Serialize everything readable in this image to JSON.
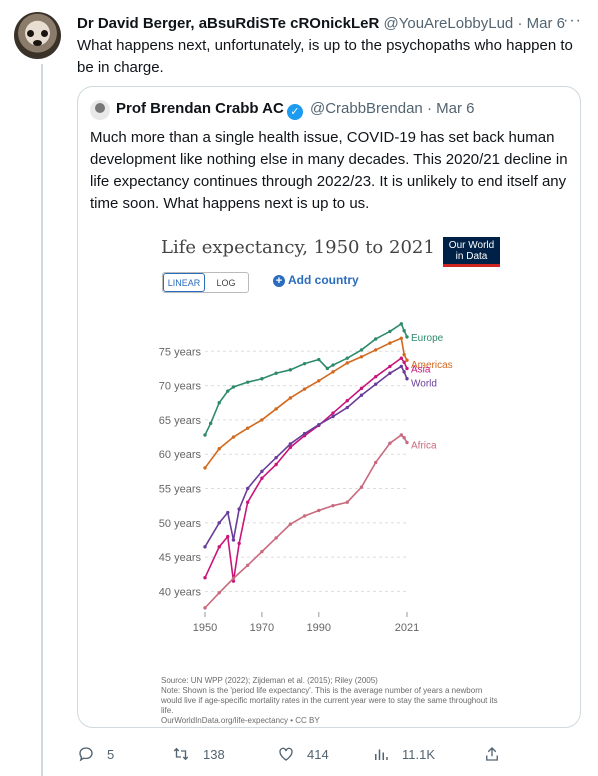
{
  "tweet": {
    "author_name": "Dr David Berger, aBsuRdiSTe cROnickLeR",
    "handle": "@YouAreLobbyLud",
    "separator": "·",
    "date": "Mar 6",
    "more_label": "···",
    "text": "What happens next, unfortunately, is up to the psychopaths who happen to be in charge."
  },
  "quoted": {
    "author_name": "Prof Brendan Crabb AC",
    "verified_mark": "✓",
    "handle": "@CrabbBrendan",
    "separator": "·",
    "date": "Mar 6",
    "text": "Much more than a single health issue, COVID-19 has set back human development like nothing else in many decades. This 2020/21 decline in life expectancy continues through 2022/23. It is unlikely to end itself any time soon. What happens next is up to us."
  },
  "chart_ui": {
    "logo_line1": "Our World",
    "logo_line2": "in Data",
    "linear_label": "LINEAR",
    "log_label": "LOG",
    "add_plus": "+",
    "add_country_label": "Add country",
    "source_line": "Source: UN WPP (2022); Zijdeman et al. (2015); Riley (2005)",
    "note_line": "Note: Shown is the 'period life expectancy'. This is the average number of years a newborn would live if age-specific mortality rates in the current year were to stay the same throughout its life.",
    "url_line": "OurWorldInData.org/life-expectancy • CC BY"
  },
  "actions": {
    "replies": "5",
    "retweets": "138",
    "likes": "414",
    "views": "11.1K"
  },
  "colors": {
    "Europe": "#2e8b6a",
    "Americas": "#d2691e",
    "Asia": "#c8157a",
    "World": "#6a3d9a",
    "Africa": "#c96a7e"
  },
  "chart_data": {
    "type": "line",
    "title": "Life expectancy, 1950 to 2021",
    "x_ticks": [
      "1950",
      "1970",
      "1990",
      "2021"
    ],
    "y_ticks": [
      "40 years",
      "45 years",
      "50 years",
      "55 years",
      "60 years",
      "65 years",
      "70 years",
      "75 years"
    ],
    "xlim": [
      1950,
      2021
    ],
    "ylim": [
      37,
      80
    ],
    "grid": true,
    "series": [
      {
        "name": "Europe",
        "x": [
          1950,
          1952,
          1955,
          1958,
          1960,
          1965,
          1970,
          1975,
          1980,
          1985,
          1990,
          1993,
          1995,
          2000,
          2005,
          2010,
          2015,
          2019,
          2020,
          2021
        ],
        "values": [
          62.8,
          64.5,
          67.5,
          69.2,
          69.8,
          70.5,
          71.0,
          71.8,
          72.3,
          73.2,
          73.8,
          72.5,
          73.0,
          74.0,
          75.2,
          76.8,
          77.9,
          79.0,
          78.0,
          77.1
        ]
      },
      {
        "name": "Americas",
        "x": [
          1950,
          1955,
          1960,
          1965,
          1970,
          1975,
          1980,
          1985,
          1990,
          1995,
          2000,
          2005,
          2010,
          2015,
          2019,
          2020,
          2021
        ],
        "values": [
          58.0,
          60.8,
          62.5,
          63.8,
          65.0,
          66.6,
          68.2,
          69.5,
          70.7,
          72.0,
          73.3,
          74.2,
          75.2,
          76.2,
          76.9,
          74.5,
          73.7
        ]
      },
      {
        "name": "Asia",
        "x": [
          1950,
          1955,
          1958,
          1960,
          1962,
          1965,
          1970,
          1975,
          1980,
          1985,
          1990,
          1995,
          2000,
          2005,
          2010,
          2015,
          2019,
          2020,
          2021
        ],
        "values": [
          42.0,
          46.5,
          48.0,
          41.5,
          47.0,
          53.0,
          56.5,
          58.5,
          61.0,
          62.7,
          64.2,
          66.0,
          67.8,
          69.6,
          71.3,
          72.8,
          74.0,
          73.4,
          72.5
        ]
      },
      {
        "name": "World",
        "x": [
          1950,
          1955,
          1958,
          1960,
          1962,
          1965,
          1970,
          1975,
          1980,
          1985,
          1990,
          1995,
          2000,
          2005,
          2010,
          2015,
          2019,
          2020,
          2021
        ],
        "values": [
          46.5,
          50.0,
          51.5,
          47.5,
          52.0,
          55.0,
          57.5,
          59.5,
          61.5,
          63.0,
          64.3,
          65.5,
          66.8,
          68.6,
          70.2,
          71.8,
          72.8,
          72.0,
          71.0
        ]
      },
      {
        "name": "Africa",
        "x": [
          1950,
          1955,
          1960,
          1965,
          1970,
          1975,
          1980,
          1985,
          1990,
          1995,
          2000,
          2005,
          2010,
          2015,
          2019,
          2020,
          2021
        ],
        "values": [
          37.6,
          39.8,
          41.9,
          43.8,
          45.8,
          47.8,
          49.8,
          51.0,
          51.8,
          52.5,
          53.0,
          55.2,
          58.8,
          61.6,
          62.8,
          62.4,
          61.7
        ]
      }
    ]
  }
}
